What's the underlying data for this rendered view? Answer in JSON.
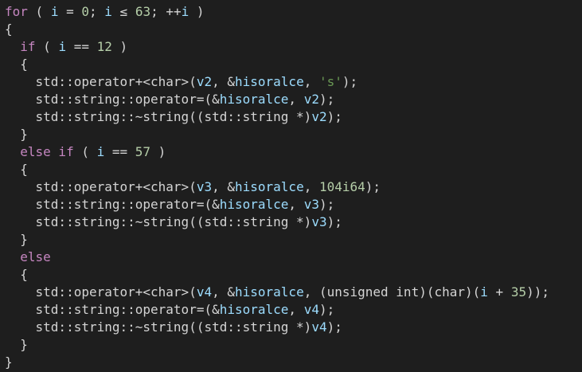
{
  "editor": {
    "lines": [
      [
        {
          "text": "for",
          "type": "keyword"
        },
        {
          "text": " ( ",
          "type": "op"
        },
        {
          "text": "i",
          "type": "var"
        },
        {
          "text": " = ",
          "type": "op"
        },
        {
          "text": "0",
          "type": "number"
        },
        {
          "text": "; ",
          "type": "op"
        },
        {
          "text": "i",
          "type": "var"
        },
        {
          "text": " ≤ ",
          "type": "op"
        },
        {
          "text": "63",
          "type": "number"
        },
        {
          "text": "; ++",
          "type": "op"
        },
        {
          "text": "i",
          "type": "var"
        },
        {
          "text": " )",
          "type": "op"
        }
      ],
      [
        {
          "text": "{",
          "type": "op"
        }
      ],
      [
        {
          "text": "  ",
          "type": "op"
        },
        {
          "text": "if",
          "type": "keyword"
        },
        {
          "text": " ( ",
          "type": "op"
        },
        {
          "text": "i",
          "type": "var"
        },
        {
          "text": " == ",
          "type": "op"
        },
        {
          "text": "12",
          "type": "number"
        },
        {
          "text": " )",
          "type": "op"
        }
      ],
      [
        {
          "text": "  {",
          "type": "op"
        }
      ],
      [
        {
          "text": "    std::operator+<char>(",
          "type": "op"
        },
        {
          "text": "v2",
          "type": "var"
        },
        {
          "text": ", &",
          "type": "op"
        },
        {
          "text": "hisoralce",
          "type": "var"
        },
        {
          "text": ", ",
          "type": "op"
        },
        {
          "text": "'s'",
          "type": "string"
        },
        {
          "text": ");",
          "type": "op"
        }
      ],
      [
        {
          "text": "    std::string::operator=(&",
          "type": "op"
        },
        {
          "text": "hisoralce",
          "type": "var"
        },
        {
          "text": ", ",
          "type": "op"
        },
        {
          "text": "v2",
          "type": "var"
        },
        {
          "text": ");",
          "type": "op"
        }
      ],
      [
        {
          "text": "    std::string::~string((std::string *)",
          "type": "op"
        },
        {
          "text": "v2",
          "type": "var"
        },
        {
          "text": ");",
          "type": "op"
        }
      ],
      [
        {
          "text": "  }",
          "type": "op"
        }
      ],
      [
        {
          "text": "  ",
          "type": "op"
        },
        {
          "text": "else if",
          "type": "keyword"
        },
        {
          "text": " ( ",
          "type": "op"
        },
        {
          "text": "i",
          "type": "var"
        },
        {
          "text": " == ",
          "type": "op"
        },
        {
          "text": "57",
          "type": "number"
        },
        {
          "text": " )",
          "type": "op"
        }
      ],
      [
        {
          "text": "  {",
          "type": "op"
        }
      ],
      [
        {
          "text": "    std::operator+<char>(",
          "type": "op"
        },
        {
          "text": "v3",
          "type": "var"
        },
        {
          "text": ", &",
          "type": "op"
        },
        {
          "text": "hisoralce",
          "type": "var"
        },
        {
          "text": ", ",
          "type": "op"
        },
        {
          "text": "104i64",
          "type": "number"
        },
        {
          "text": ");",
          "type": "op"
        }
      ],
      [
        {
          "text": "    std::string::operator=(&",
          "type": "op"
        },
        {
          "text": "hisoralce",
          "type": "var"
        },
        {
          "text": ", ",
          "type": "op"
        },
        {
          "text": "v3",
          "type": "var"
        },
        {
          "text": ");",
          "type": "op"
        }
      ],
      [
        {
          "text": "    std::string::~string((std::string *)",
          "type": "op"
        },
        {
          "text": "v3",
          "type": "var"
        },
        {
          "text": ");",
          "type": "op"
        }
      ],
      [
        {
          "text": "  }",
          "type": "op"
        }
      ],
      [
        {
          "text": "  ",
          "type": "op"
        },
        {
          "text": "else",
          "type": "keyword"
        }
      ],
      [
        {
          "text": "  {",
          "type": "op"
        }
      ],
      [
        {
          "text": "    std::operator+<char>(",
          "type": "op"
        },
        {
          "text": "v4",
          "type": "var"
        },
        {
          "text": ", &",
          "type": "op"
        },
        {
          "text": "hisoralce",
          "type": "var"
        },
        {
          "text": ", (unsigned int)(char)(",
          "type": "op"
        },
        {
          "text": "i",
          "type": "var"
        },
        {
          "text": " + ",
          "type": "op"
        },
        {
          "text": "35",
          "type": "number"
        },
        {
          "text": "));",
          "type": "op"
        }
      ],
      [
        {
          "text": "    std::string::operator=(&",
          "type": "op"
        },
        {
          "text": "hisoralce",
          "type": "var"
        },
        {
          "text": ", ",
          "type": "op"
        },
        {
          "text": "v4",
          "type": "var"
        },
        {
          "text": ");",
          "type": "op"
        }
      ],
      [
        {
          "text": "    std::string::~string((std::string *)",
          "type": "op"
        },
        {
          "text": "v4",
          "type": "var"
        },
        {
          "text": ");",
          "type": "op"
        }
      ],
      [
        {
          "text": "  }",
          "type": "op"
        }
      ],
      [
        {
          "text": "}",
          "type": "op"
        }
      ]
    ]
  },
  "colors": {
    "background": "#1e1e1e",
    "default_text": "#d4d4d4",
    "keyword": "#c586c0",
    "number": "#b5cea8",
    "string": "#6a9955",
    "variable": "#9cdcfe"
  }
}
